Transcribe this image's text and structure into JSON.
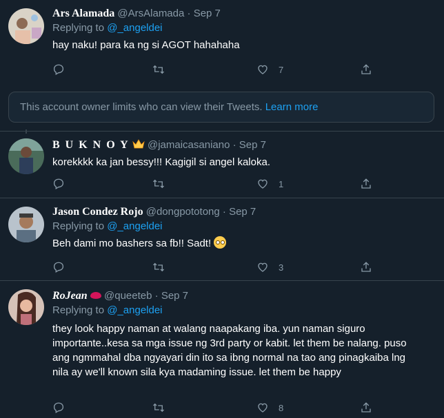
{
  "tweets": [
    {
      "name": "Ars Alamada",
      "handle": "@ArsAlamada",
      "date": "Sep 7",
      "replying_prefix": "Replying to",
      "replying_handle": "@_angeldei",
      "text": "hay naku! para ka ng si AGOT hahahaha",
      "likes": "7"
    },
    {
      "name": "B U K N O Y",
      "handle": "@jamaicasaniano",
      "date": "Sep 7",
      "text": "korekkkk ka jan bessy!!! Kagigil si angel kaloka.",
      "likes": "1"
    },
    {
      "name": "Jason Condez Rojo",
      "handle": "@dongpototong",
      "date": "Sep 7",
      "replying_prefix": "Replying to",
      "replying_handle": "@_angeldei",
      "text": "Beh dami mo bashers sa fb!! Sadt!",
      "likes": "3"
    },
    {
      "name": "RoJean",
      "handle": "@queeteb",
      "date": "Sep 7",
      "replying_prefix": "Replying to",
      "replying_handle": "@_angeldei",
      "text": "they look happy naman at walang naapakang iba. yun naman siguro importante..kesa sa mga issue ng 3rd party or kabit. let them be nalang. puso ang ngmmahal dba ngyayari din ito sa ibng normal na tao ang pinagkaiba lng nila ay we'll known sila kya madaming issue. let them be happy",
      "likes": "8"
    }
  ],
  "notice": {
    "text": "This account owner limits who can view their Tweets.",
    "link": "Learn more"
  },
  "separator": "·",
  "icons": [
    "reply-icon",
    "retweet-icon",
    "like-icon",
    "share-icon"
  ],
  "colors": {
    "background": "#15202b",
    "accent": "#1da1f2",
    "muted": "#8899a6",
    "border": "#38444d"
  }
}
